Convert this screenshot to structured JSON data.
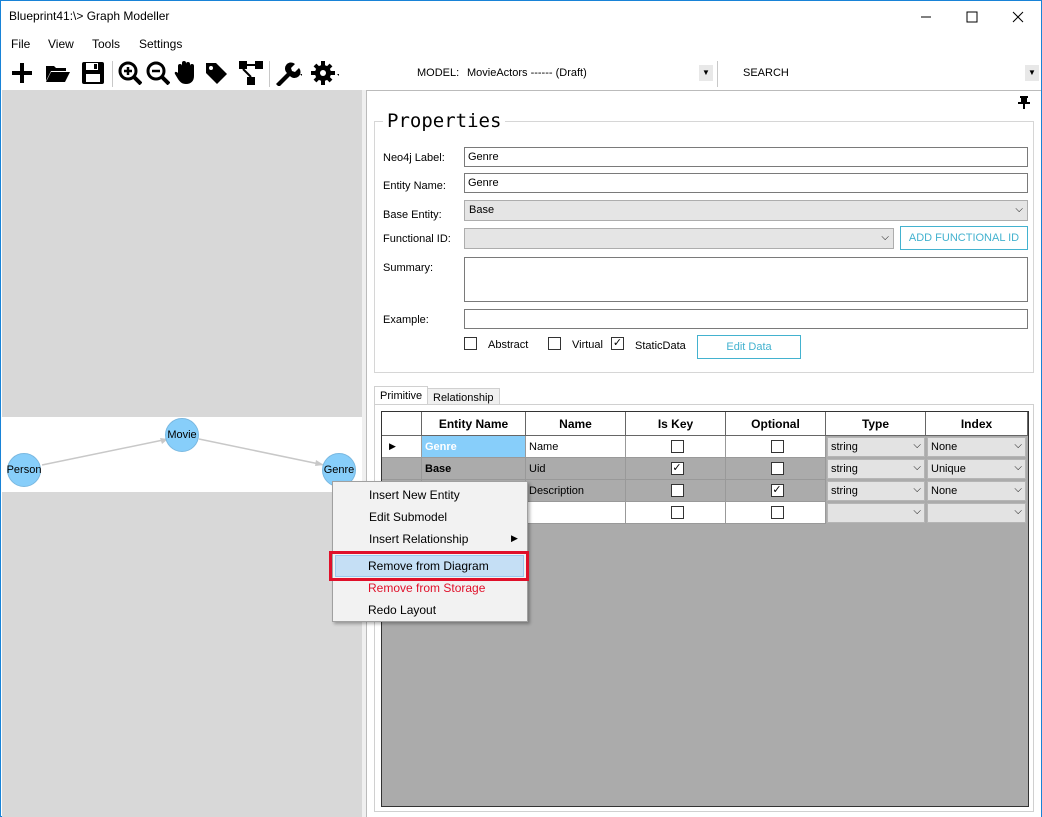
{
  "window": {
    "title": "Blueprint41:\\> Graph Modeller"
  },
  "menubar": {
    "items": [
      "File",
      "View",
      "Tools",
      "Settings"
    ]
  },
  "toolbar": {
    "icons": [
      "plus-icon",
      "folder-open-icon",
      "save-icon",
      "zoom-in-icon",
      "zoom-out-icon",
      "hand-icon",
      "tag-icon",
      "hierarchy-icon",
      "wrench-icon",
      "gear-icon"
    ],
    "model_label": "MODEL:",
    "model_value": "MovieActors ------ (Draft)",
    "search_label": "SEARCH"
  },
  "diagram": {
    "nodes": [
      "Movie",
      "Person",
      "Genre"
    ]
  },
  "context_menu": {
    "items": [
      "Insert New Entity",
      "Edit Submodel",
      "Insert Relationship",
      "Remove from Diagram",
      "Remove from Storage",
      "Redo Layout"
    ],
    "selected": "Remove from Diagram"
  },
  "properties": {
    "title": "Properties",
    "neo4j_label": "Neo4j Label:",
    "neo4j_value": "Genre",
    "entity_name_label": "Entity Name:",
    "entity_name_value": "Genre",
    "base_entity_label": "Base Entity:",
    "base_entity_value": "Base",
    "functional_id_label": "Functional ID:",
    "functional_id_value": "",
    "add_functional_id": "ADD FUNCTIONAL ID",
    "summary_label": "Summary:",
    "example_label": "Example:",
    "abstract_label": "Abstract",
    "virtual_label": "Virtual",
    "staticdata_label": "StaticData",
    "abstract_checked": false,
    "virtual_checked": false,
    "staticdata_checked": true,
    "edit_data": "Edit Data"
  },
  "tabs": [
    "Primitive",
    "Relationship"
  ],
  "grid": {
    "headers": [
      "Entity Name",
      "Name",
      "Is Key",
      "Optional",
      "Type",
      "Index"
    ],
    "rows": [
      {
        "entity": "Genre",
        "name": "Name",
        "is_key": false,
        "optional": false,
        "type": "string",
        "index": "None"
      },
      {
        "entity": "Base",
        "name": "Uid",
        "is_key": true,
        "optional": false,
        "type": "string",
        "index": "Unique"
      },
      {
        "entity": "",
        "name": "Description",
        "is_key": false,
        "optional": true,
        "type": "string",
        "index": "None"
      },
      {
        "entity": "",
        "name": "",
        "is_key": false,
        "optional": false,
        "type": "",
        "index": ""
      }
    ]
  },
  "colors": {
    "node_fill": "#87cefa",
    "accent": "#43b2cf",
    "danger": "#e0102a",
    "selection": "#c5dff5"
  }
}
